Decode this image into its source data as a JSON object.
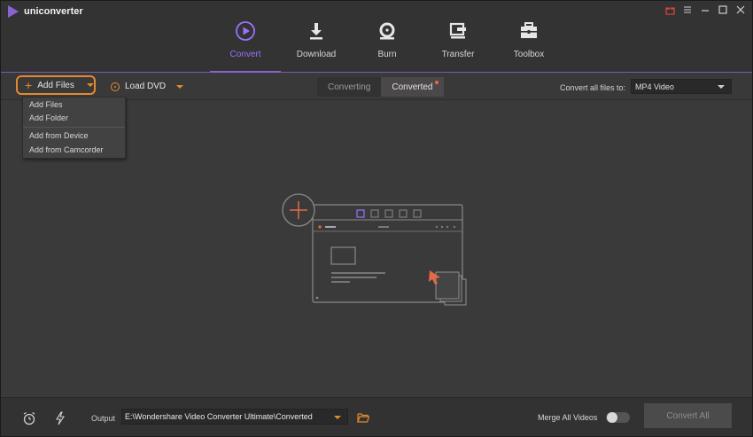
{
  "app": {
    "name": "uniconverter"
  },
  "window_controls": [
    {
      "name": "gift-icon",
      "glyph": "🎁"
    },
    {
      "name": "menu-icon",
      "glyph": "☰"
    },
    {
      "name": "minimize-icon",
      "glyph": "—"
    },
    {
      "name": "maximize-icon",
      "glyph": "☐"
    },
    {
      "name": "close-icon",
      "glyph": "✕"
    }
  ],
  "nav": {
    "items": [
      {
        "label": "Convert",
        "icon": "convert-icon",
        "active": true
      },
      {
        "label": "Download",
        "icon": "download-icon",
        "active": false
      },
      {
        "label": "Burn",
        "icon": "burn-icon",
        "active": false
      },
      {
        "label": "Transfer",
        "icon": "transfer-icon",
        "active": false
      },
      {
        "label": "Toolbox",
        "icon": "toolbox-icon",
        "active": false
      }
    ]
  },
  "toolbar": {
    "add_files_label": "Add Files",
    "load_dvd_label": "Load DVD",
    "tab_converting": "Converting",
    "tab_converted": "Converted",
    "convert_all_label": "Convert all files to:",
    "format_value": "MP4 Video"
  },
  "add_menu": {
    "items": [
      "Add Files",
      "Add Folder",
      "Add from Device",
      "Add from Camcorder"
    ]
  },
  "bottom": {
    "output_label": "Output",
    "output_path": "E:\\Wondershare Video Converter Ultimate\\Converted",
    "merge_label": "Merge All Videos",
    "merge_on": false,
    "convert_all_button": "Convert All"
  },
  "colors": {
    "accent": "#8a63d2",
    "orange": "#e08a2e",
    "background": "#3b3a3a"
  }
}
